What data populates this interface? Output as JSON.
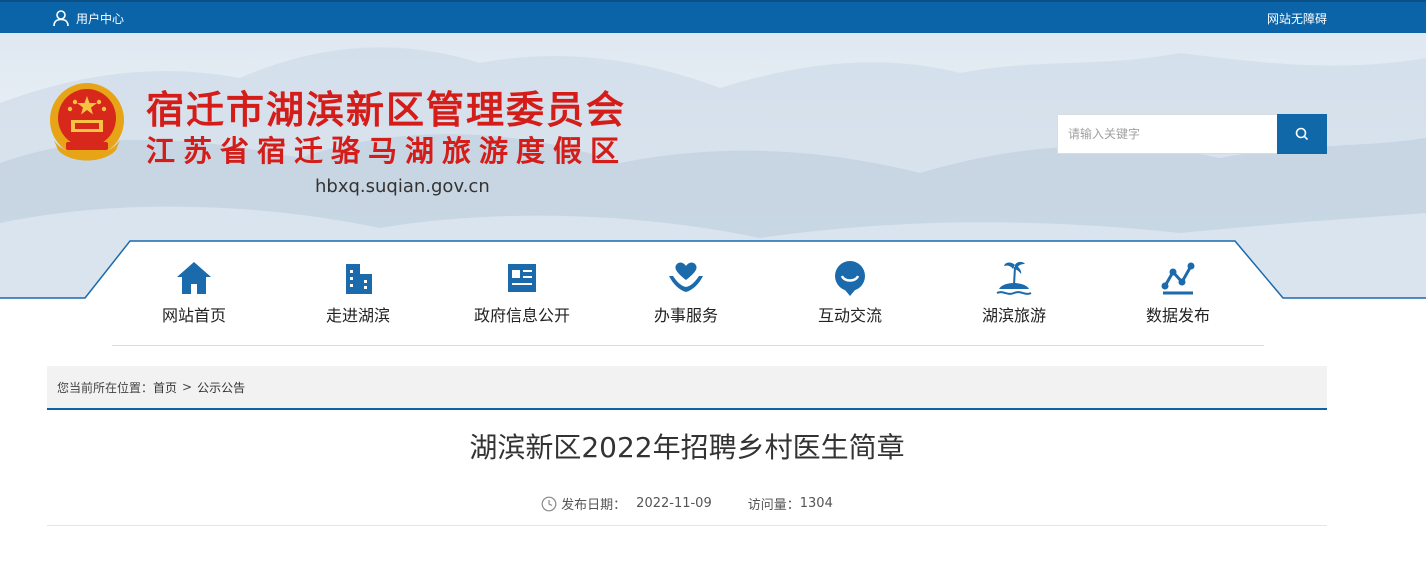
{
  "topbar": {
    "user_center": "用户中心",
    "accessibility": "网站无障碍"
  },
  "header": {
    "title_line1": "宿迁市湖滨新区管理委员会",
    "title_line2": "江苏省宿迁骆马湖旅游度假区",
    "domain": "hbxq.suqian.gov.cn",
    "emblem_icon": "national-emblem-icon"
  },
  "search": {
    "placeholder": "请输入关键字",
    "button_icon": "search-icon"
  },
  "nav": {
    "items": [
      {
        "label": "网站首页",
        "icon": "home-icon"
      },
      {
        "label": "走进湖滨",
        "icon": "buildings-icon"
      },
      {
        "label": "政府信息公开",
        "icon": "document-icon"
      },
      {
        "label": "办事服务",
        "icon": "hands-heart-icon"
      },
      {
        "label": "互动交流",
        "icon": "chat-bubble-icon"
      },
      {
        "label": "湖滨旅游",
        "icon": "island-palm-icon"
      },
      {
        "label": "数据发布",
        "icon": "line-chart-icon"
      }
    ]
  },
  "breadcrumb": {
    "prefix": "您当前所在位置：",
    "home": "首页",
    "separator": ">",
    "current": "公示公告"
  },
  "article": {
    "title": "湖滨新区2022年招聘乡村医生简章",
    "date_label": "发布日期：",
    "date": "2022-11-09",
    "views_label": "访问量：",
    "views": "1304"
  },
  "colors": {
    "brand_blue": "#0b64a8",
    "title_red": "#d41d18"
  }
}
